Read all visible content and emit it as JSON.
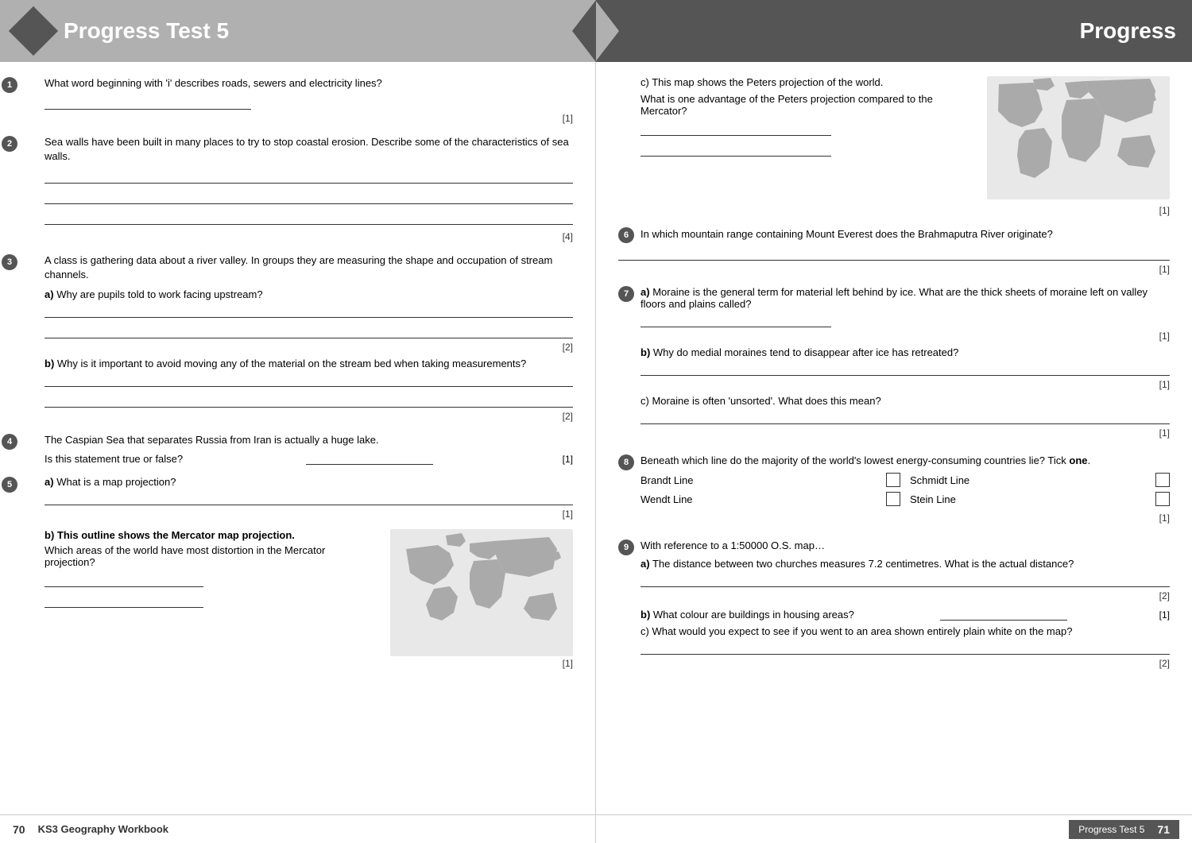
{
  "left_header": {
    "title": "Progress Test 5"
  },
  "right_header": {
    "title": "Progress"
  },
  "left_questions": [
    {
      "id": "1",
      "text": "What word beginning with 'i' describes roads, sewers and electricity lines?",
      "answer_lines": 1,
      "mark": "[1]"
    },
    {
      "id": "2",
      "text": "Sea walls have been built in many places to try to stop coastal erosion. Describe some of the characteristics of sea walls.",
      "answer_lines": 4,
      "mark": "[4]"
    },
    {
      "id": "3",
      "text": "A class is gathering data about a river valley. In groups they are measuring the shape and occupation of stream channels.",
      "sub": [
        {
          "label": "a)",
          "text": "Why are pupils told to work facing upstream?",
          "answer_lines": 2,
          "mark": "[2]"
        },
        {
          "label": "b)",
          "text": "Why is it important to avoid moving any of the material on the stream bed when taking measurements?",
          "answer_lines": 2,
          "mark": "[2]"
        }
      ]
    },
    {
      "id": "4",
      "text": "The Caspian Sea that separates Russia from Iran is actually a huge lake.",
      "inline": "Is this statement true or false?",
      "answer_inline": true,
      "mark": "[1]"
    },
    {
      "id": "5",
      "sub_a_text": "What is a map projection?",
      "sub_a_mark": "[1]",
      "sub_b_heading": "b) This outline shows the Mercator map projection.",
      "sub_b_question": "Which areas of the world have most distortion in the Mercator projection?",
      "sub_b_answer_lines": 2,
      "sub_b_mark": "[1]"
    }
  ],
  "right_questions": [
    {
      "id": "5c",
      "intro": "c)  This map shows the Peters projection of the world.",
      "question": "What is one advantage of the Peters projection compared to the Mercator?",
      "answer_lines": 2,
      "mark": "[1]"
    },
    {
      "id": "6",
      "text": "In which mountain range containing Mount Everest does the Brahmaputra River originate?",
      "answer_lines": 1,
      "mark": "[1]"
    },
    {
      "id": "7",
      "sub": [
        {
          "label": "a)",
          "text": "Moraine is the general term for material left behind by ice. What are the thick sheets of moraine left on valley floors and plains called?",
          "answer_lines": 1,
          "mark": "[1]"
        },
        {
          "label": "b)",
          "text": "Why do medial moraines tend to disappear after ice has retreated?",
          "answer_lines": 1,
          "mark": "[1]"
        },
        {
          "label": "c)",
          "text": "Moraine is often 'unsorted'. What does this mean?",
          "answer_lines": 1,
          "mark": "[1]"
        }
      ]
    },
    {
      "id": "8",
      "text": "Beneath which line do the majority of the world's lowest energy-consuming countries lie? Tick one.",
      "options": [
        {
          "label": "Brandt Line",
          "col": 1
        },
        {
          "label": "Schmidt Line",
          "col": 2
        },
        {
          "label": "Wendt Line",
          "col": 1
        },
        {
          "label": "Stein Line",
          "col": 2
        }
      ],
      "mark": "[1]"
    },
    {
      "id": "9",
      "intro": "With reference to a 1:50000 O.S. map…",
      "sub": [
        {
          "label": "a)",
          "text": "The distance between two churches measures 7.2 centimetres. What is the actual distance?",
          "answer_lines": 1,
          "mark": "[2]"
        },
        {
          "label": "b)",
          "text": "What colour are buildings in housing areas?",
          "answer_inline": true,
          "mark": "[1]"
        },
        {
          "label": "c)",
          "text": "What would you expect to see if you went to an area shown entirely plain white on the map?",
          "answer_lines": 1,
          "mark": "[2]"
        }
      ]
    }
  ],
  "footer": {
    "left_page_num": "70",
    "left_title": "KS3 Geography Workbook",
    "right_label": "Progress Test 5",
    "right_page_num": "71"
  }
}
